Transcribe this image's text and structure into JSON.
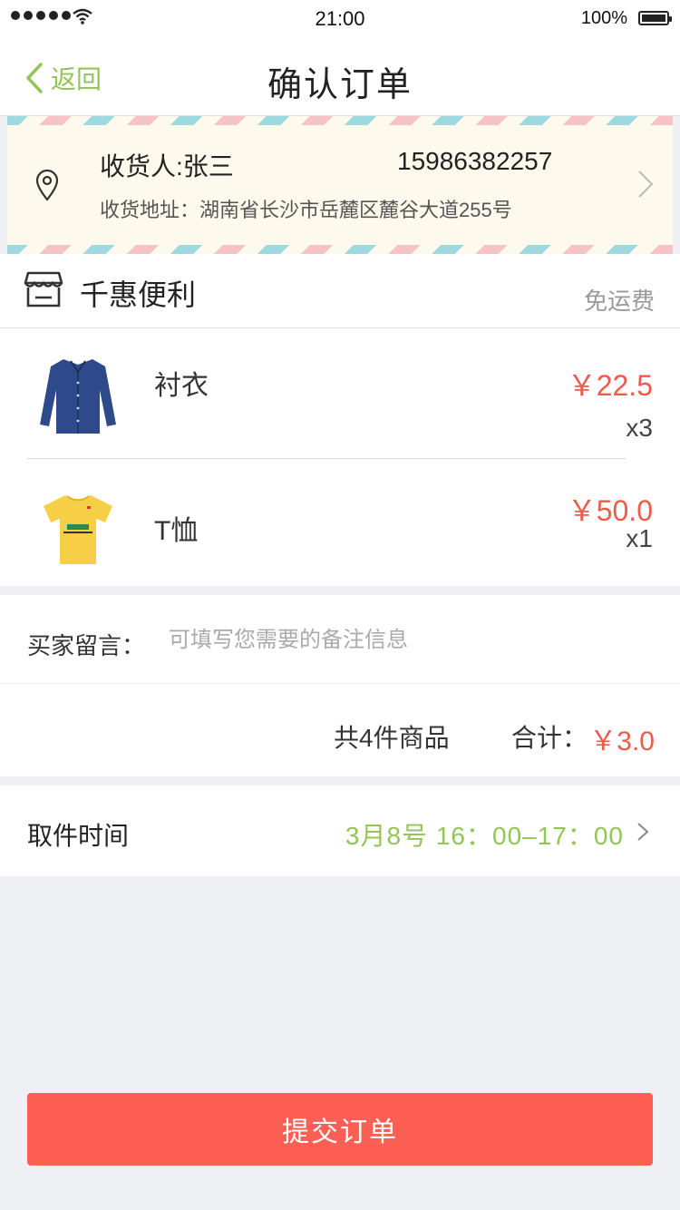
{
  "status_bar": {
    "time": "21:00",
    "battery": "100%"
  },
  "nav": {
    "back_label": "返回",
    "title": "确认订单"
  },
  "address": {
    "receiver": "收货人:张三",
    "phone": "15986382257",
    "address": "收货地址：湖南省长沙市岳麓区麓谷大道255号"
  },
  "store": {
    "name": "千惠便利",
    "shipping": "免运费"
  },
  "items": [
    {
      "name": "衬衣",
      "price": "￥22.5",
      "qty": "x3",
      "image": "shirt"
    },
    {
      "name": "T恤",
      "price": "￥50.0",
      "qty": "x1",
      "image": "tshirt"
    }
  ],
  "message": {
    "label": "买家留言：",
    "placeholder": "可填写您需要的备注信息"
  },
  "summary": {
    "count": "共4件商品",
    "total_label": "合计：",
    "total_value": "￥3.0"
  },
  "pickup": {
    "label": "取件时间",
    "time": "3月8号  16：00–17：00"
  },
  "submit_label": "提交订单",
  "colors": {
    "accent_green": "#93c556",
    "price_red": "#f05a4a",
    "submit_red": "#fe5f54"
  }
}
